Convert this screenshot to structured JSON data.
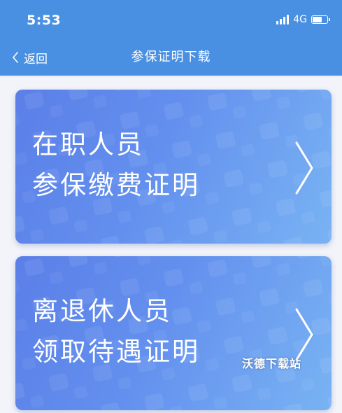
{
  "status_bar": {
    "time": "5:53",
    "network": "4G",
    "icons": [
      "signal-icon",
      "battery-icon"
    ]
  },
  "nav": {
    "back_label": "返回",
    "title": "参保证明下载",
    "background": "#4a90e2"
  },
  "cards": [
    {
      "line1": "在职人员",
      "line2": "参保缴费证明",
      "icon": "chevron-right-icon"
    },
    {
      "line1": "离退休人员",
      "line2": "领取待遇证明",
      "icon": "chevron-right-icon"
    }
  ],
  "watermark": "沃德下载站",
  "colors": {
    "card_gradient_start": "#5b7fe8",
    "card_gradient_end": "#79b3f3",
    "text": "#ffffff"
  }
}
